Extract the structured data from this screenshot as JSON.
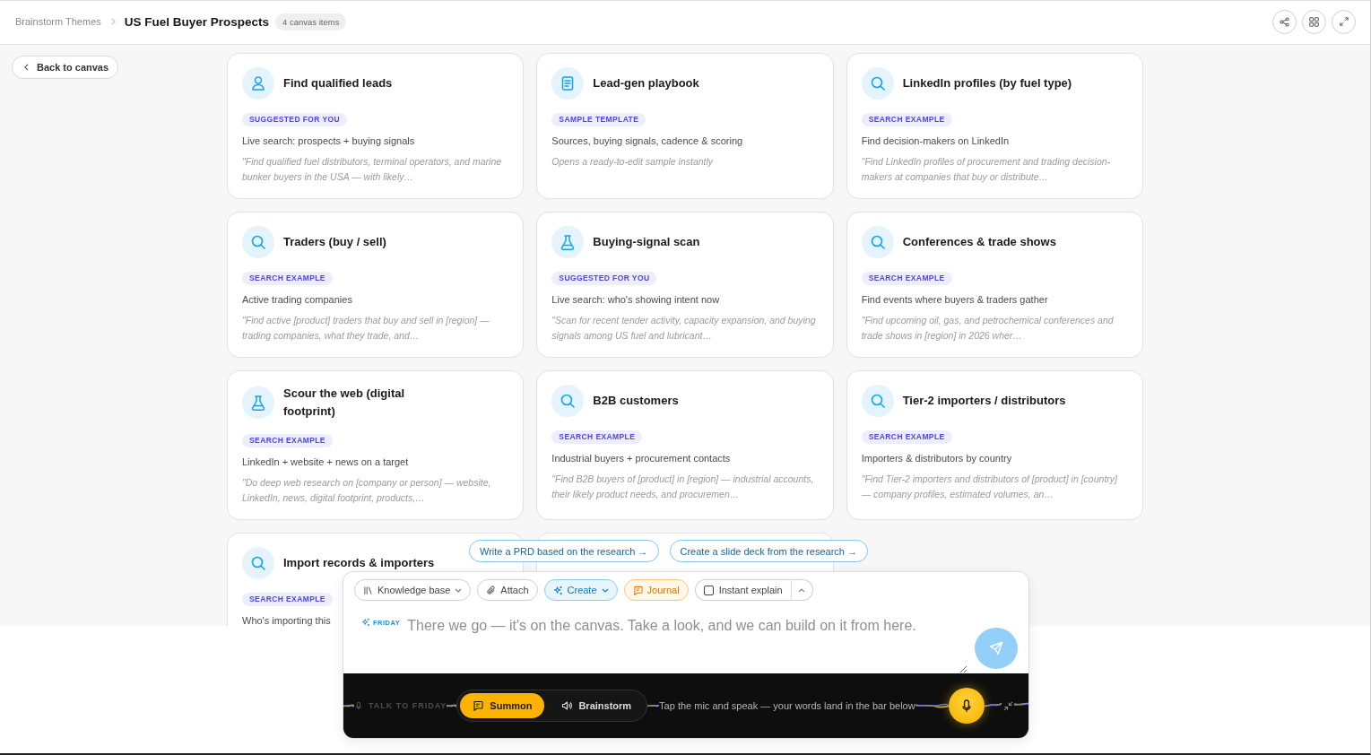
{
  "header": {
    "breadcrumb": "Brainstorm Themes",
    "title": "US Fuel Buyer Prospects",
    "item_count": "4 canvas items"
  },
  "back_button": {
    "label": "Back to canvas"
  },
  "cards": [
    {
      "kind": "leads",
      "title": "Find qualified leads",
      "badge": "SUGGESTED FOR YOU",
      "subtitle": "Live search: prospects + buying signals",
      "prompt": "\"Find qualified fuel distributors, terminal operators, and marine bunker buyers in the USA — with likely…"
    },
    {
      "kind": "template",
      "title": "Lead-gen playbook",
      "badge": "SAMPLE TEMPLATE",
      "subtitle": "Sources, buying signals, cadence & scoring",
      "prompt": "Opens a ready-to-edit sample instantly"
    },
    {
      "kind": "search",
      "title": "LinkedIn profiles (by fuel type)",
      "badge": "SEARCH EXAMPLE",
      "subtitle": "Find decision-makers on LinkedIn",
      "prompt": "\"Find LinkedIn profiles of procurement and trading decision-makers at companies that buy or distribute…"
    },
    {
      "kind": "search",
      "title": "Traders (buy / sell)",
      "badge": "SEARCH EXAMPLE",
      "subtitle": "Active trading companies",
      "prompt": "\"Find active [product] traders that buy and sell in [region] — trading companies, what they trade, and…"
    },
    {
      "kind": "lab",
      "title": "Buying-signal scan",
      "badge": "SUGGESTED FOR YOU",
      "subtitle": "Live search: who's showing intent now",
      "prompt": "\"Scan for recent tender activity, capacity expansion, and buying signals among US fuel and lubricant…"
    },
    {
      "kind": "search",
      "title": "Conferences & trade shows",
      "badge": "SEARCH EXAMPLE",
      "subtitle": "Find events where buyers & traders gather",
      "prompt": "\"Find upcoming oil, gas, and petrochemical conferences and trade shows in [region] in 2026 wher…"
    },
    {
      "kind": "lab",
      "title": "Scour the web (digital footprint)",
      "badge": "SEARCH EXAMPLE",
      "subtitle": "LinkedIn + website + news on a target",
      "prompt": "\"Do deep web research on [company or person] — website, LinkedIn, news, digital footprint, products,…"
    },
    {
      "kind": "search",
      "title": "B2B customers",
      "badge": "SEARCH EXAMPLE",
      "subtitle": "Industrial buyers + procurement contacts",
      "prompt": "\"Find B2B buyers of [product] in [region] — industrial accounts, their likely product needs, and procuremen…"
    },
    {
      "kind": "search",
      "title": "Tier-2 importers / distributors",
      "badge": "SEARCH EXAMPLE",
      "subtitle": "Importers & distributors by country",
      "prompt": "\"Find Tier-2 importers and distributors of [product] in [country] — company profiles, estimated volumes, an…"
    },
    {
      "kind": "search",
      "title": "Import records & importers",
      "badge": "SEARCH EXAMPLE",
      "subtitle": "Who's importing this"
    },
    {
      "kind": "blank"
    }
  ],
  "suggestions": [
    "Write a PRD based on the research →",
    "Create a slide deck from the research →"
  ],
  "composer": {
    "knowledge_base": "Knowledge base",
    "attach": "Attach",
    "create": {
      "label": "Create",
      "active": true
    },
    "journal": {
      "label": "Journal",
      "active": true
    },
    "instant_explain": {
      "label": "Instant explain",
      "checked": false
    },
    "assistant": "FRIDAY",
    "placeholder": "There we go — it's on the canvas. Take a look, and we can build on it from here."
  },
  "voice": {
    "label": "TALK TO FRIDAY",
    "modes": [
      {
        "label": "Summon",
        "selected": true
      },
      {
        "label": "Brainstorm",
        "selected": false
      }
    ],
    "hint": "Tap the mic and speak — your words land in the bar below"
  }
}
